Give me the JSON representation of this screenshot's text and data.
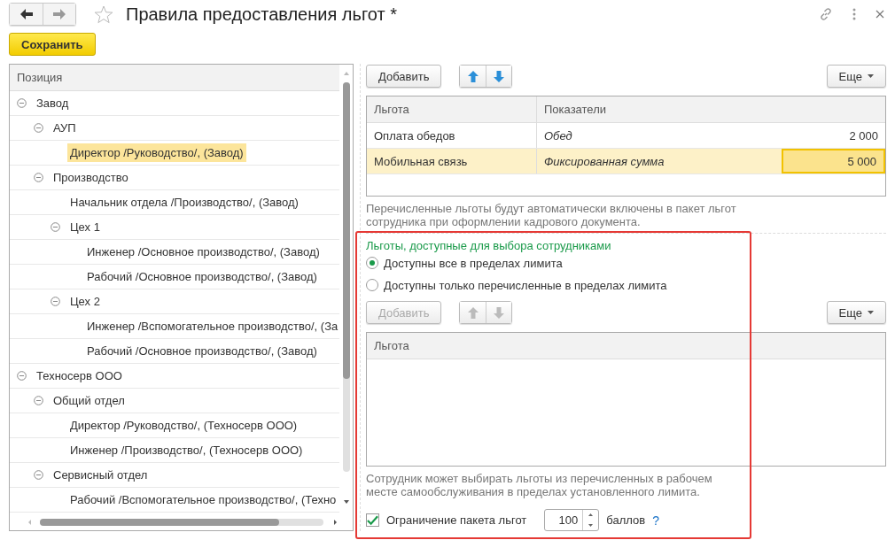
{
  "window": {
    "title": "Правила предоставления льгот *"
  },
  "toolbar": {
    "save_button": "Сохранить"
  },
  "tree": {
    "column": "Позиция",
    "items": [
      {
        "label": "Завод",
        "expanded": true,
        "selected": false,
        "children": [
          {
            "label": "АУП",
            "expanded": true,
            "selected": false,
            "children": [
              {
                "label": "Директор /Руководство/, (Завод)",
                "selected": true
              }
            ]
          },
          {
            "label": "Производство",
            "expanded": true,
            "selected": false,
            "children": [
              {
                "label": "Начальник отдела /Производство/, (Завод)",
                "selected": false
              },
              {
                "label": "Цех 1",
                "expanded": true,
                "selected": false,
                "children": [
                  {
                    "label": "Инженер /Основное производство/, (Завод)",
                    "selected": false
                  },
                  {
                    "label": "Рабочий /Основное производство/, (Завод)",
                    "selected": false
                  }
                ]
              },
              {
                "label": "Цех 2",
                "expanded": true,
                "selected": false,
                "children": [
                  {
                    "label": "Инженер /Вспомогательное производство/, (За",
                    "selected": false
                  },
                  {
                    "label": "Рабочий /Основное производство/, (Завод)",
                    "selected": false
                  }
                ]
              }
            ]
          }
        ]
      },
      {
        "label": "Техносерв ООО",
        "expanded": true,
        "selected": false,
        "children": [
          {
            "label": "Общий отдел",
            "expanded": true,
            "selected": false,
            "children": [
              {
                "label": "Директор /Руководство/, (Техносерв ООО)",
                "selected": false
              },
              {
                "label": "Инженер /Производство/, (Техносерв ООО)",
                "selected": false
              }
            ]
          },
          {
            "label": "Сервисный отдел",
            "expanded": true,
            "selected": false,
            "children": [
              {
                "label": "Рабочий /Вспомогательное производство/, (Техно",
                "selected": false
              }
            ]
          }
        ]
      }
    ]
  },
  "benefits": {
    "add_button": "Добавить",
    "more_button": "Еще",
    "columns": [
      "Льгота",
      "Показатели"
    ],
    "rows": [
      {
        "benefit": "Оплата обедов",
        "indicator": "Обед",
        "amount": "2 000",
        "selected": false
      },
      {
        "benefit": "Мобильная связь",
        "indicator": "Фиксированная сумма",
        "amount": "5 000",
        "selected": true
      }
    ],
    "note": "Перечисленные льготы будут автоматически включены в пакет льгот сотрудника при оформлении кадрового документа."
  },
  "choice": {
    "title": "Льготы, доступные для выбора сотрудниками",
    "options": [
      {
        "label": "Доступны все в пределах лимита",
        "selected": true
      },
      {
        "label": "Доступны только перечисленные в пределах лимита",
        "selected": false
      }
    ],
    "add_button": "Добавить",
    "add_disabled": true,
    "more_button": "Еще",
    "column": "Льгота",
    "note": "Сотрудник может выбирать льготы из перечисленных в рабочем месте самообслуживания в пределах установленного лимита.",
    "limit": {
      "label": "Ограничение пакета льгот",
      "checked": true,
      "value": "100",
      "unit": "баллов",
      "help": "?"
    }
  }
}
